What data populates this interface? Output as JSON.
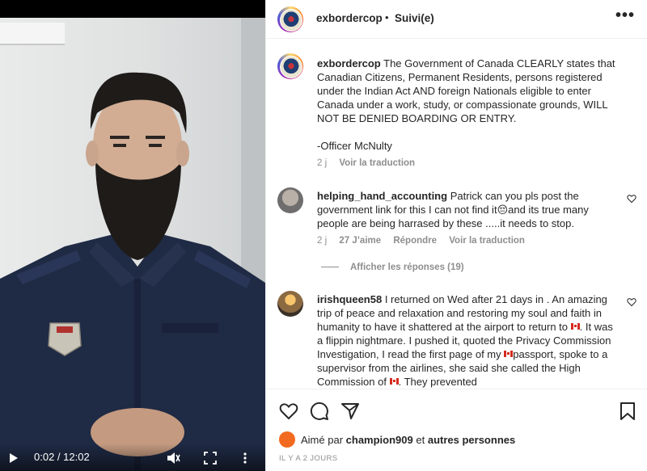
{
  "video": {
    "time": "0:02 / 12:02"
  },
  "header": {
    "username": "exbordercop",
    "separator": "•",
    "follow_status": "Suivi(e)",
    "more": "•••"
  },
  "caption": {
    "username": "exbordercop",
    "text": "The Government of Canada CLEARLY states that Canadian Citizens, Permanent Residents, persons registered under the Indian Act AND foreign Nationals eligible to enter Canada under a work, study, or compassionate grounds, WILL NOT BE DENIED BOARDING OR ENTRY.",
    "signature": "-Officer McNulty",
    "age": "2 j",
    "translate": "Voir la traduction"
  },
  "comments": [
    {
      "username": "helping_hand_accounting",
      "text_before_emoji": "Patrick can you pls post the government link for this I can not find it",
      "emoji": "😔",
      "text_after_emoji": "and its true many people are being harrased by these .....it needs to stop.",
      "age": "2 j",
      "likes": "27 J’aime",
      "reply": "Répondre",
      "translate": "Voir la traduction",
      "replies_label": "Afficher les réponses (19)"
    },
    {
      "username": "irishqueen58",
      "part1": "I returned on Wed after 21 days in . An amazing trip of peace and relaxation and restoring my soul and faith in humanity to have it shattered at the airport to return to",
      "part2": ". It was a flippin nightmare. I pushed it, quoted the Privacy Commission Investigation, I read the first page of my",
      "part3": "passport, spoke to a supervisor from the airlines, she said she called the High Commission of",
      "part4": ". They prevented"
    }
  ],
  "actions": {
    "liked_by_prefix": "Aimé par",
    "liked_by_user": "champion909",
    "liked_by_and": "et",
    "liked_by_others": "autres personnes",
    "date": "IL Y A 2 JOURS"
  },
  "colors": {
    "accent_orange": "#f26a1f",
    "muted_text": "#8e8e8e",
    "uniform_navy": "#1f2a44"
  }
}
